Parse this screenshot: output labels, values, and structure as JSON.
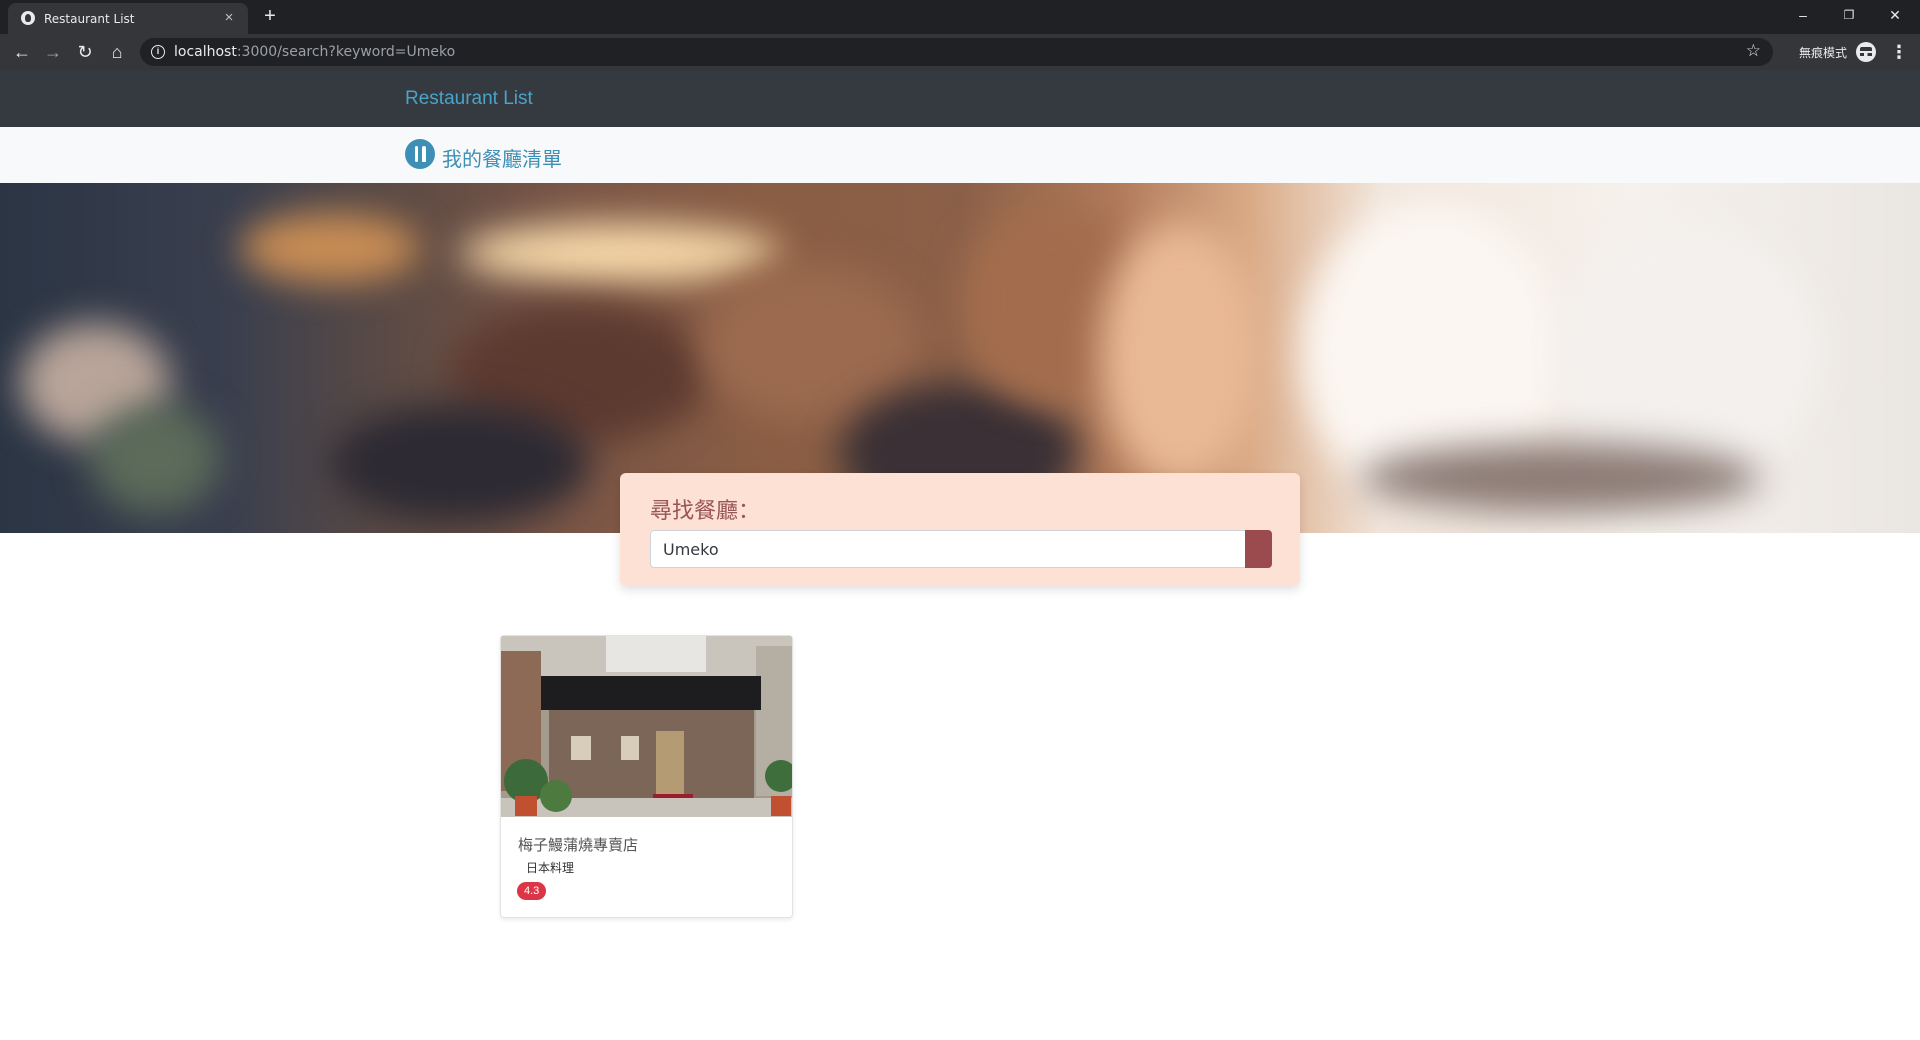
{
  "browser": {
    "tab_title": "Restaurant List",
    "tab_close": "×",
    "new_tab": "+",
    "url_host": "localhost",
    "url_rest": ":3000/search?keyword=Umeko",
    "incognito_label": "無痕模式",
    "window_controls": {
      "minimize": "–",
      "restore": "❐",
      "close": "✕"
    },
    "nav": {
      "back": "←",
      "forward": "→",
      "reload": "↻",
      "home": "⌂",
      "star": "☆",
      "menu": "⋮",
      "info": "i"
    }
  },
  "navbar": {
    "brand": "Restaurant List"
  },
  "subbar": {
    "title": "我的餐廳清單"
  },
  "search": {
    "label": "尋找餐廳：",
    "value": "Umeko"
  },
  "results": [
    {
      "name": "梅子鰻蒲燒專賣店",
      "category": "日本料理",
      "rating": "4.3"
    }
  ],
  "colors": {
    "navbar_bg": "#343a40",
    "brand": "#4aa3c9",
    "search_card_bg": "#fde1d4",
    "search_button": "#9b4a4e",
    "rating_badge": "#dc3545"
  }
}
